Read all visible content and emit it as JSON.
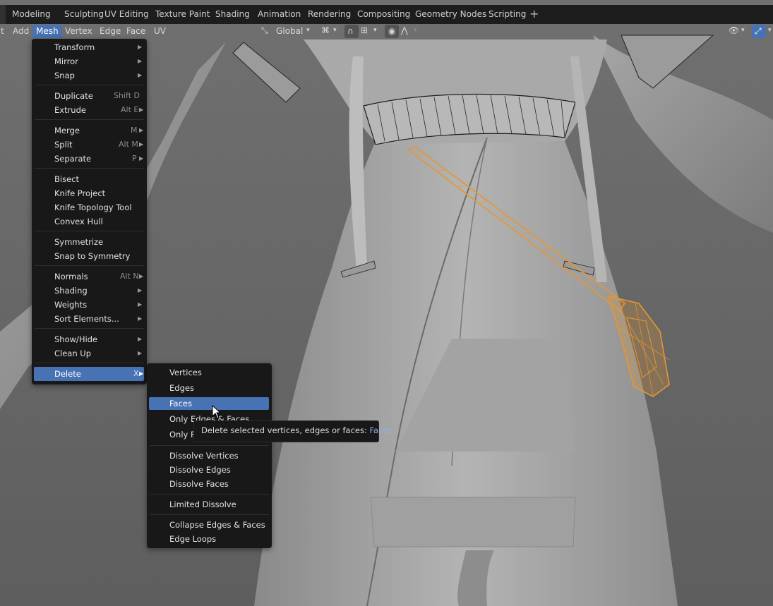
{
  "workspace_tabs": [
    "Modeling",
    "Sculpting",
    "UV Editing",
    "Texture Paint",
    "Shading",
    "Animation",
    "Rendering",
    "Compositing",
    "Geometry Nodes",
    "Scripting"
  ],
  "add_tab_symbol": "+",
  "header": {
    "menus": [
      "t",
      "Add",
      "Mesh",
      "Vertex",
      "Edge",
      "Face",
      "UV"
    ],
    "transform_orientation": "Global"
  },
  "mesh_menu": {
    "items": [
      {
        "label": "Transform",
        "shortcut": "",
        "submenu": true
      },
      {
        "label": "Mirror",
        "shortcut": "",
        "submenu": true
      },
      {
        "label": "Snap",
        "shortcut": "",
        "submenu": true
      },
      {
        "label": "Duplicate",
        "shortcut": "Shift D",
        "submenu": false
      },
      {
        "label": "Extrude",
        "shortcut": "Alt E",
        "submenu": true
      },
      {
        "label": "Merge",
        "shortcut": "M",
        "submenu": true
      },
      {
        "label": "Split",
        "shortcut": "Alt M",
        "submenu": true
      },
      {
        "label": "Separate",
        "shortcut": "P",
        "submenu": true
      },
      {
        "label": "Bisect",
        "shortcut": "",
        "submenu": false
      },
      {
        "label": "Knife Project",
        "shortcut": "",
        "submenu": false
      },
      {
        "label": "Knife Topology Tool",
        "shortcut": "",
        "submenu": false
      },
      {
        "label": "Convex Hull",
        "shortcut": "",
        "submenu": false
      },
      {
        "label": "Symmetrize",
        "shortcut": "",
        "submenu": false
      },
      {
        "label": "Snap to Symmetry",
        "shortcut": "",
        "submenu": false
      },
      {
        "label": "Normals",
        "shortcut": "Alt N",
        "submenu": true
      },
      {
        "label": "Shading",
        "shortcut": "",
        "submenu": true
      },
      {
        "label": "Weights",
        "shortcut": "",
        "submenu": true
      },
      {
        "label": "Sort Elements...",
        "shortcut": "",
        "submenu": true
      },
      {
        "label": "Show/Hide",
        "shortcut": "",
        "submenu": true
      },
      {
        "label": "Clean Up",
        "shortcut": "",
        "submenu": true
      },
      {
        "label": "Delete",
        "shortcut": "X",
        "submenu": true
      }
    ]
  },
  "delete_menu": {
    "items": [
      {
        "label": "Vertices"
      },
      {
        "label": "Edges"
      },
      {
        "label": "Faces"
      },
      {
        "label": "Only Edges & Faces"
      },
      {
        "label": "Only Faces"
      },
      {
        "label": "Dissolve Vertices"
      },
      {
        "label": "Dissolve Edges"
      },
      {
        "label": "Dissolve Faces"
      },
      {
        "label": "Limited Dissolve"
      },
      {
        "label": "Collapse Edges & Faces"
      },
      {
        "label": "Edge Loops"
      }
    ]
  },
  "tooltip": {
    "text": "Delete selected vertices, edges or faces:",
    "value": "Faces"
  },
  "colors": {
    "accent": "#4772b3",
    "selection": "#e8962f",
    "menu_bg": "#181818"
  }
}
